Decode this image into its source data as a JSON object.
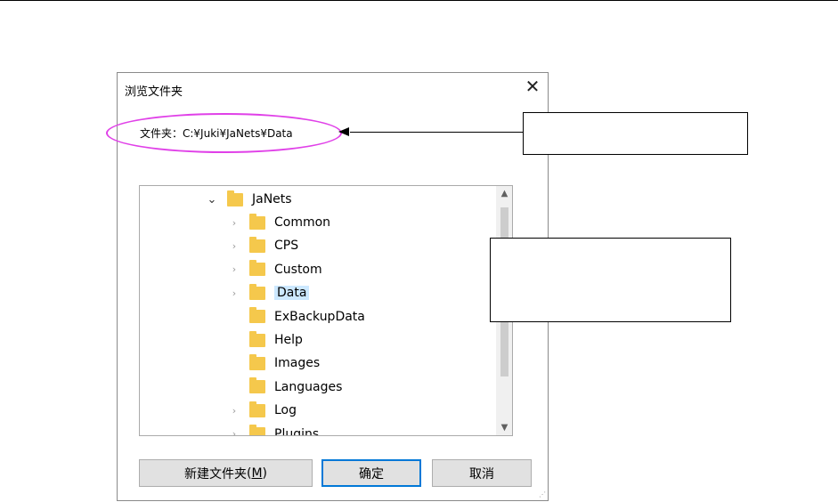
{
  "dialog": {
    "title": "浏览文件夹",
    "close_glyph": "✕",
    "folder_label": "文件夹：C:¥Juki¥JaNets¥Data"
  },
  "tree": {
    "root": {
      "label": "JaNets",
      "expanded": true,
      "chevron": "⌄"
    },
    "items": [
      {
        "label": "Common",
        "expandable": true
      },
      {
        "label": "CPS",
        "expandable": true
      },
      {
        "label": "Custom",
        "expandable": true
      },
      {
        "label": "Data",
        "expandable": true,
        "selected": true
      },
      {
        "label": "ExBackupData",
        "expandable": false
      },
      {
        "label": "Help",
        "expandable": false
      },
      {
        "label": "Images",
        "expandable": false
      },
      {
        "label": "Languages",
        "expandable": false
      },
      {
        "label": "Log",
        "expandable": true
      },
      {
        "label": "Plugins",
        "expandable": true
      }
    ],
    "collapsed_chevron": "›",
    "scroll_up": "▲",
    "scroll_down": "▼"
  },
  "buttons": {
    "new_folder": "新建文件夹",
    "new_folder_accesskey": "M",
    "ok": "确定",
    "cancel": "取消"
  },
  "colors": {
    "highlight": "#e040e8",
    "selection": "#cce8ff",
    "folder": "#f5c84c",
    "default_button_border": "#0078d7"
  }
}
